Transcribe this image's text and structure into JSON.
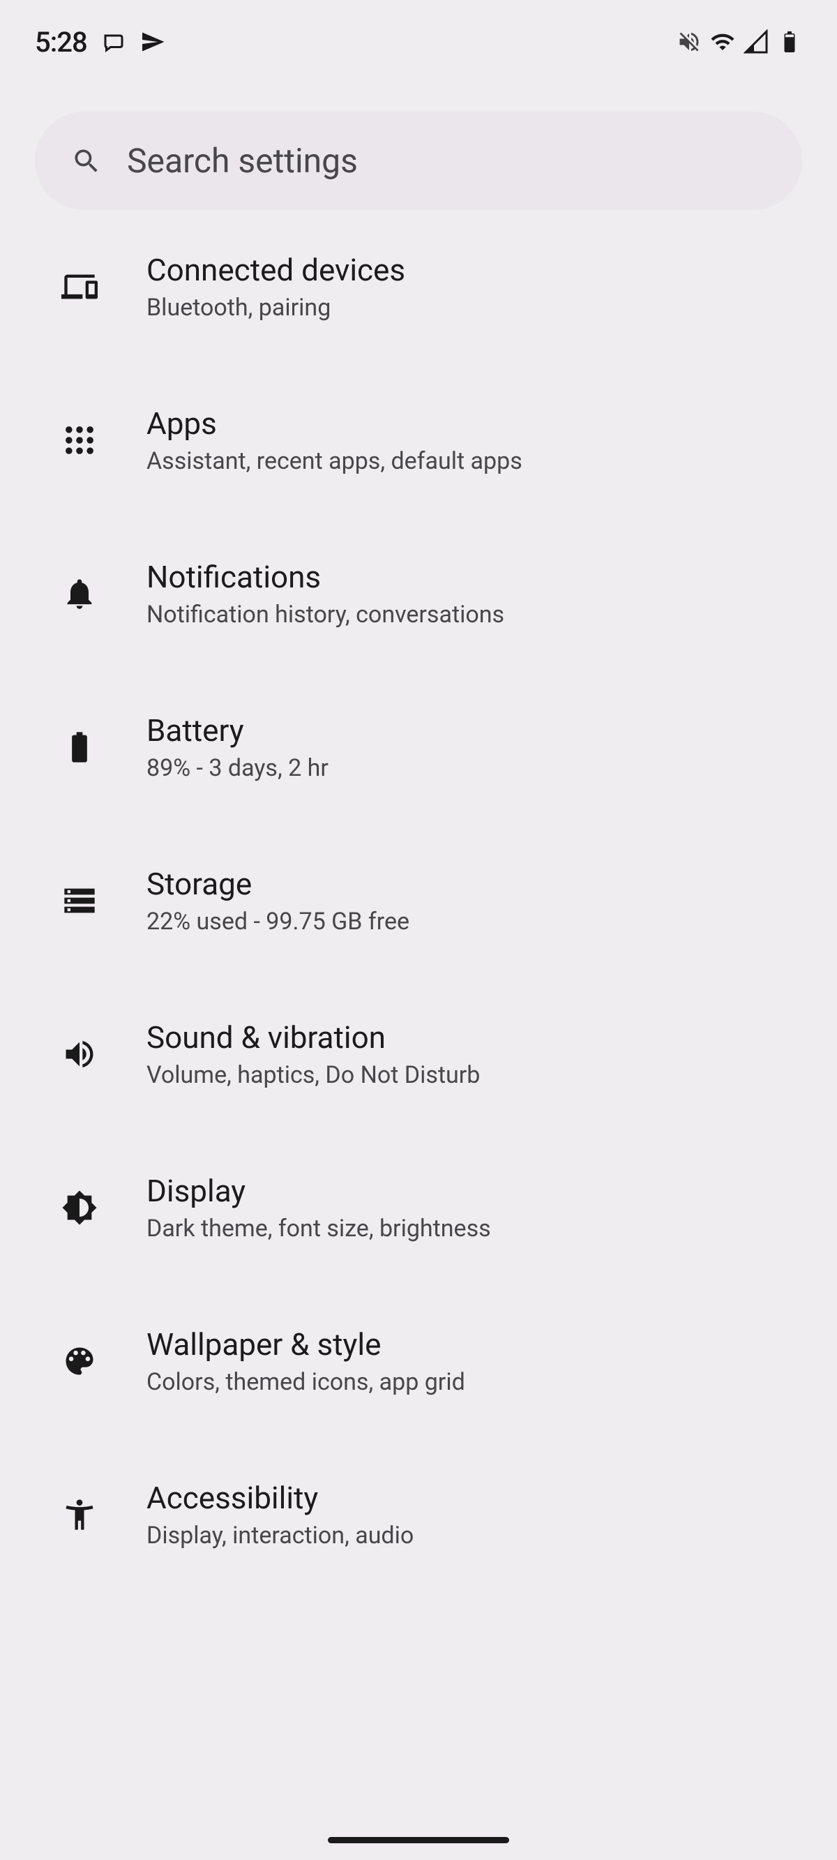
{
  "status_bar": {
    "clock": "5:28"
  },
  "search": {
    "placeholder": "Search settings"
  },
  "settings": {
    "connected_devices": {
      "title": "Connected devices",
      "subtitle": "Bluetooth, pairing"
    },
    "apps": {
      "title": "Apps",
      "subtitle": "Assistant, recent apps, default apps"
    },
    "notifications": {
      "title": "Notifications",
      "subtitle": "Notification history, conversations"
    },
    "battery": {
      "title": "Battery",
      "subtitle": "89% - 3 days, 2 hr"
    },
    "storage": {
      "title": "Storage",
      "subtitle": "22% used - 99.75 GB free"
    },
    "sound": {
      "title": "Sound & vibration",
      "subtitle": "Volume, haptics, Do Not Disturb"
    },
    "display": {
      "title": "Display",
      "subtitle": "Dark theme, font size, brightness"
    },
    "wallpaper": {
      "title": "Wallpaper & style",
      "subtitle": "Colors, themed icons, app grid"
    },
    "accessibility": {
      "title": "Accessibility",
      "subtitle": "Display, interaction, audio"
    }
  }
}
